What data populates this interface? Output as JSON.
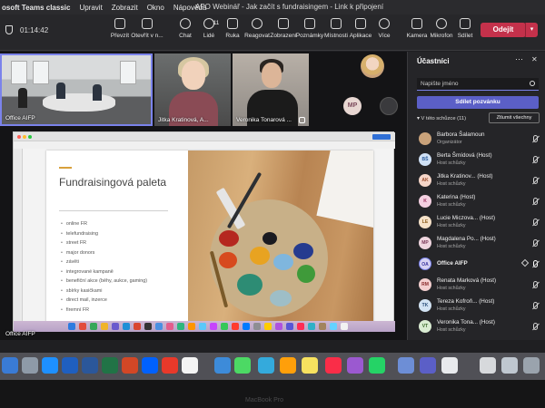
{
  "menubar": {
    "app": "osoft Teams classic",
    "items": [
      "Upravit",
      "Zobrazit",
      "Okno",
      "Nápověda"
    ],
    "window_title": "APO Webinář - Jak začít s fundraisingem - Link k připojení"
  },
  "toolbar": {
    "timer": "01:14:42",
    "buttons": [
      {
        "label": "Převzít",
        "icon": "present-icon"
      },
      {
        "label": "Otevřít v n...",
        "icon": "open-icon"
      },
      {
        "label": "Chat",
        "icon": "chat-icon"
      },
      {
        "label": "Lidé",
        "icon": "people-icon",
        "count": "11"
      },
      {
        "label": "Ruka",
        "icon": "hand-icon"
      },
      {
        "label": "Reagovat",
        "icon": "emoji-icon"
      },
      {
        "label": "Zobrazení",
        "icon": "view-icon"
      },
      {
        "label": "Poznámky",
        "icon": "notes-icon"
      },
      {
        "label": "Místnosti",
        "icon": "rooms-icon"
      },
      {
        "label": "Aplikace",
        "icon": "apps-icon"
      },
      {
        "label": "Více",
        "icon": "more-icon"
      },
      {
        "label": "Kamera",
        "icon": "camera-icon"
      },
      {
        "label": "Mikrofon",
        "icon": "mic-icon"
      },
      {
        "label": "Sdílet",
        "icon": "share-icon"
      }
    ],
    "leave_label": "Odejít"
  },
  "stage": {
    "tiles": [
      {
        "name": "Office AIFP"
      },
      {
        "name": "Jitka Kratinová, A..."
      },
      {
        "name": "Veronika Tonarová ..."
      }
    ],
    "avatar_initials": "MP",
    "presenter_label": "Office AIFP"
  },
  "slide": {
    "title": "Fundraisingová paleta",
    "bullets": [
      "online FR",
      "telefundraising",
      "street FR",
      "major donors",
      "závěti",
      "integrované kampaně",
      "benefiční akce (běhy, aukce, gaming)",
      "sbírky kasičkami",
      "direct mail, inzerce",
      "firemní FR"
    ]
  },
  "panel": {
    "title": "Účastníci",
    "search_placeholder": "Napište jméno",
    "invite_label": "Sdílet pozvánku",
    "section_label": "V této schůzce (11)",
    "admit_all_label": "Ztlumit všechny",
    "participants": [
      {
        "name": "Barbora Šalamoun",
        "role": "Organizátor",
        "initials": "",
        "bg": "#c9a27a",
        "fg": "#4b2e1b"
      },
      {
        "name": "Berta Šmídová (Host)",
        "role": "Host schůzky",
        "initials": "BŠ",
        "bg": "#cfe0f5",
        "fg": "#2a5a9a"
      },
      {
        "name": "Jitka Kratinov...  (Host)",
        "role": "Host schůzky",
        "initials": "AK",
        "bg": "#f5d5c8",
        "fg": "#9a4a2a"
      },
      {
        "name": "Katerina (Host)",
        "role": "Host schůzky",
        "initials": "K",
        "bg": "#f3cfe0",
        "fg": "#9a2a5a"
      },
      {
        "name": "Lucie Miczova... (Host)",
        "role": "Host schůzky",
        "initials": "LE",
        "bg": "#f5e1c8",
        "fg": "#8a5a1a"
      },
      {
        "name": "Magdalena Po... (Host)",
        "role": "Host schůzky",
        "initials": "MP",
        "bg": "#efd5df",
        "fg": "#7c3a5a"
      },
      {
        "name": "Office AIFP",
        "role": "",
        "initials": "OA",
        "bg": "#d6d2f2",
        "fg": "#3b36a0"
      },
      {
        "name": "Renata Marková (Host)",
        "role": "Host schůzky",
        "initials": "RM",
        "bg": "#f3cfcf",
        "fg": "#8a2a2a"
      },
      {
        "name": "Tereza Kofroň... (Host)",
        "role": "Host schůzky",
        "initials": "TK",
        "bg": "#d2e3f3",
        "fg": "#2a4e7a"
      },
      {
        "name": "Veronika Tona... (Host)",
        "role": "Host schůzky",
        "initials": "VT",
        "bg": "#d9ecd2",
        "fg": "#3a6a2a"
      }
    ]
  },
  "device": {
    "label": "MacBook Pro"
  }
}
